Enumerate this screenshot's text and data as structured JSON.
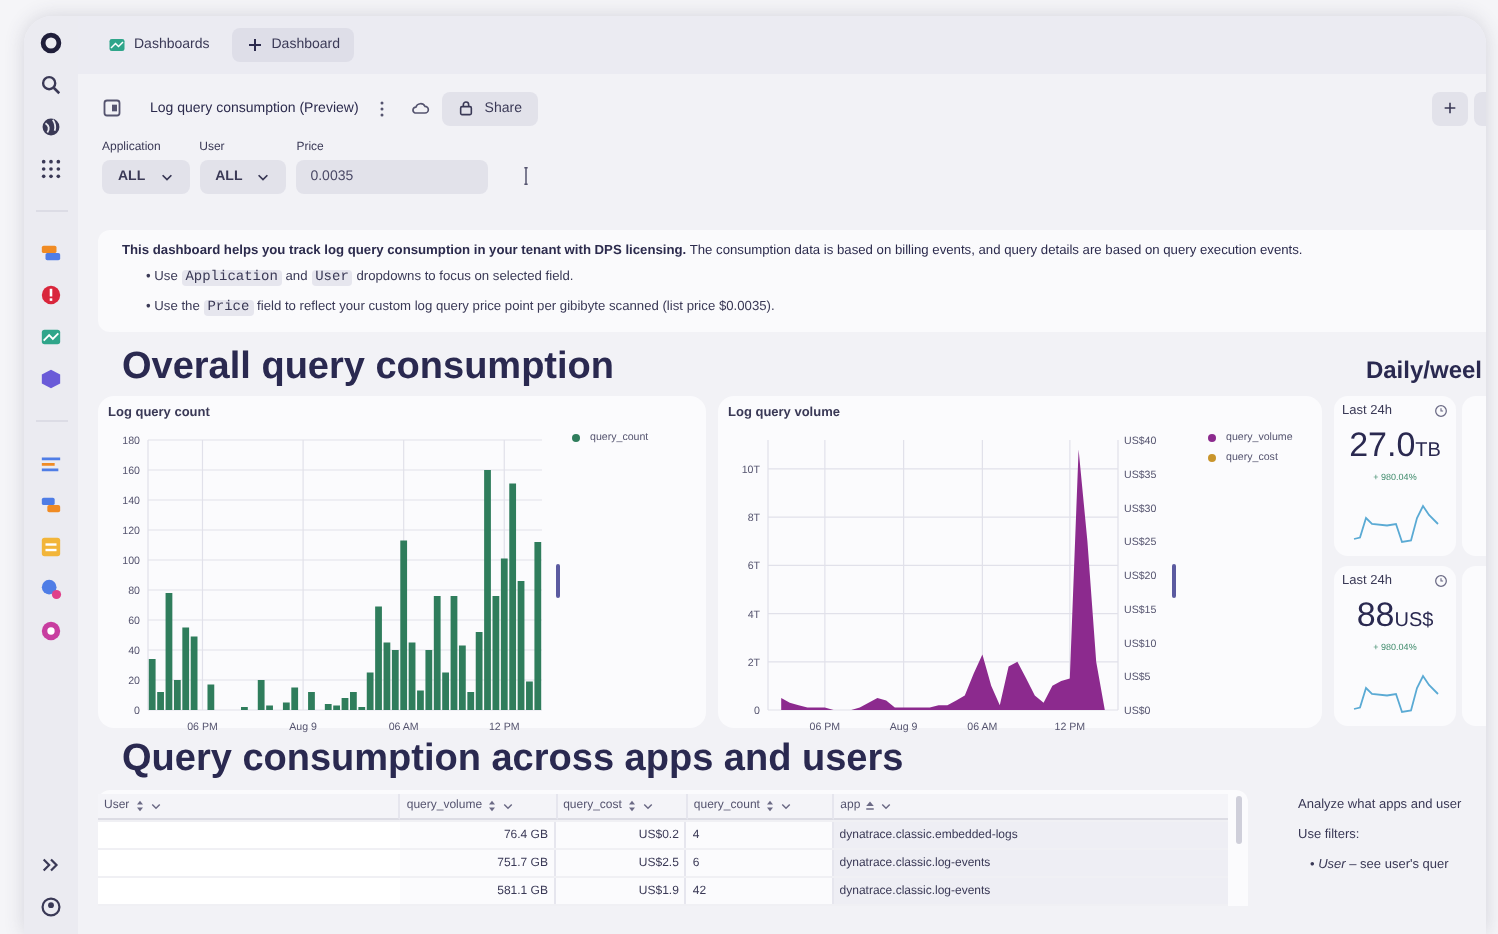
{
  "top_bar": {
    "tabs": [
      {
        "label": "Dashboards",
        "kind": "app",
        "selected": false
      },
      {
        "label": "Dashboard",
        "kind": "new",
        "selected": true
      }
    ]
  },
  "toolbar": {
    "title": "Log query consumption (Preview)",
    "share": "Share"
  },
  "filters": [
    {
      "kind": "dropdown",
      "label": "Application",
      "value": "ALL"
    },
    {
      "kind": "dropdown",
      "label": "User",
      "value": "ALL"
    },
    {
      "kind": "input",
      "label": "Price",
      "value": "0.0035"
    }
  ],
  "info": {
    "intro": "**This dashboard helps you track log query consumption in your tenant with DPS licensing.** The consumption data is based on billing events, and query details are based on query execution events.",
    "bullets": [
      [
        {
          "kind": "text",
          "text": "• Use "
        },
        {
          "kind": "code",
          "text": "Application"
        },
        {
          "kind": "text",
          "text": " and "
        },
        {
          "kind": "code",
          "text": "User"
        },
        {
          "kind": "text",
          "text": " dropdowns to focus on selected field."
        }
      ],
      [
        {
          "kind": "text",
          "text": "• Use the "
        },
        {
          "kind": "code",
          "text": "Price"
        },
        {
          "kind": "text",
          "text": " field to reflect your custom log query price point per gibibyte scanned (list price $0.0035)."
        }
      ]
    ]
  },
  "overall": {
    "heading": "Overall query consumption",
    "side_heading": "Daily/weel",
    "charts": [
      {
        "chart_data": {
          "type": "bar",
          "title": "Log query count",
          "grid": true,
          "categories": [
            null,
            null,
            null,
            null,
            null,
            null,
            "06 PM",
            null,
            null,
            null,
            null,
            null,
            null,
            null,
            null,
            null,
            null,
            null,
            "Aug 9",
            null,
            null,
            null,
            null,
            null,
            null,
            null,
            null,
            null,
            null,
            null,
            "06 AM",
            null,
            null,
            null,
            null,
            null,
            null,
            null,
            null,
            null,
            null,
            null,
            "12 PM",
            null,
            null,
            null,
            null
          ],
          "ylim": [
            0,
            180
          ],
          "yticks": [
            0,
            20,
            40,
            60,
            80,
            100,
            120,
            140,
            160,
            180
          ],
          "series": [
            {
              "name": "query_count",
              "color": "#2f7d5c",
              "values": [
                34,
                12,
                78,
                20,
                55,
                49,
                0,
                17,
                0,
                0,
                0,
                2,
                0,
                20,
                3,
                0,
                5,
                15,
                0,
                12,
                0,
                4,
                3,
                8,
                12,
                2,
                25,
                69,
                45,
                40,
                113,
                45,
                13,
                40,
                76,
                25,
                76,
                43,
                12,
                52,
                160,
                76,
                101,
                151,
                86,
                19,
                112
              ]
            }
          ]
        }
      },
      {
        "right_axis_labels": [
          "US$40",
          "US$35",
          "US$30",
          "US$25",
          "US$20",
          "US$15",
          "US$10",
          "US$5",
          "US$0"
        ],
        "chart_data": {
          "type": "area",
          "title": "Log query volume",
          "grid": true,
          "categories": [
            null,
            null,
            null,
            null,
            null,
            null,
            "06 PM",
            null,
            null,
            null,
            null,
            null,
            null,
            null,
            null,
            "Aug 9",
            null,
            null,
            null,
            null,
            null,
            null,
            null,
            null,
            "06 AM",
            null,
            null,
            null,
            null,
            null,
            null,
            null,
            null,
            null,
            "12 PM",
            null,
            null,
            null,
            null,
            null
          ],
          "ylim": [
            0,
            11.2
          ],
          "yticks": [
            {
              "value": 0,
              "label": "0"
            },
            {
              "value": 2,
              "label": "2T"
            },
            {
              "value": 4,
              "label": "4T"
            },
            {
              "value": 6,
              "label": "6T"
            },
            {
              "value": 8,
              "label": "8T"
            },
            {
              "value": 10,
              "label": "10T"
            }
          ],
          "series": [
            {
              "name": "query_volume",
              "color": "#8c2a8e",
              "values": [
                null,
                0.5,
                0.3,
                0.2,
                0.1,
                0.1,
                0.1,
                0,
                0,
                0,
                0.1,
                0.3,
                0.5,
                0.4,
                0.1,
                0.1,
                0.1,
                0.1,
                0.1,
                0.2,
                0.2,
                0.4,
                0.6,
                1.5,
                2.3,
                1.0,
                0.2,
                1.8,
                2.0,
                1.3,
                0.6,
                0.3,
                1.0,
                1.2,
                1.3,
                10.8,
                7.0,
                2.0,
                0,
                null
              ]
            },
            {
              "name": "query_cost",
              "color": "#c9952c",
              "values": [
                null,
                null,
                null,
                null,
                null,
                null,
                null,
                null,
                null,
                null,
                null,
                null,
                null,
                null,
                null,
                null,
                null,
                null,
                null,
                null,
                null,
                null,
                null,
                null,
                null,
                null,
                null,
                null,
                null,
                null,
                null,
                null,
                null,
                null,
                null,
                null,
                null,
                null,
                null,
                null
              ]
            }
          ]
        }
      }
    ],
    "stats": [
      {
        "period": "Last 24h",
        "value": "27.0",
        "unit": "TB",
        "change": "+ 980.04%"
      },
      {
        "period": "Last 24h",
        "value": "88",
        "unit": "US$",
        "change": "+ 980.04%"
      }
    ]
  },
  "usage": {
    "heading": "Query consumption across apps and users",
    "columns": [
      {
        "label": "User",
        "sorted": false
      },
      {
        "label": "query_volume",
        "sorted": false
      },
      {
        "label": "query_cost",
        "sorted": false
      },
      {
        "label": "query_count",
        "sorted": false
      },
      {
        "label": "app",
        "sorted": true
      }
    ],
    "rows": [
      {
        "query_volume": "76.4 GB",
        "query_cost": "US$0.2",
        "query_count": "4",
        "app": "dynatrace.classic.embedded-logs"
      },
      {
        "query_volume": "751.7 GB",
        "query_cost": "US$2.5",
        "query_count": "6",
        "app": "dynatrace.classic.log-events"
      },
      {
        "query_volume": "581.1 GB",
        "query_cost": "US$1.9",
        "query_count": "42",
        "app": "dynatrace.classic.log-events"
      }
    ],
    "notes": [
      "Analyze what apps and user",
      "Use filters:"
    ],
    "note_bullets": [
      "• *User* – see user's quer"
    ]
  }
}
